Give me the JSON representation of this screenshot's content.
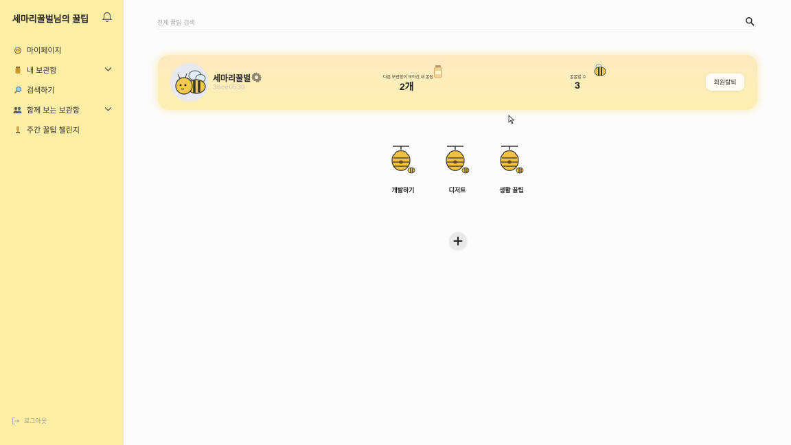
{
  "sidebar": {
    "title": "세마리꿀벌님의 꿀팁",
    "items": [
      {
        "label": "마이페이지",
        "icon": "bee-face-icon",
        "has_chevron": false
      },
      {
        "label": "내 보관함",
        "icon": "jar-icon",
        "has_chevron": true
      },
      {
        "label": "검색하기",
        "icon": "magnifier-icon",
        "has_chevron": false
      },
      {
        "label": "함께 보는 보관함",
        "icon": "people-icon",
        "has_chevron": true
      },
      {
        "label": "주간 꿀팁 챌린지",
        "icon": "trophy-icon",
        "has_chevron": false
      }
    ],
    "logout_label": "로그아웃"
  },
  "search": {
    "placeholder": "전체 꿀팁 검색"
  },
  "profile": {
    "nickname": "세마리꿀벌",
    "user_id": "3bee0530",
    "stat_folders_label": "다른 보관함이 모아간 내 꿀팁",
    "stat_folders_value": "2개",
    "stat_bees_label": "꿀꿀벌 수",
    "stat_bees_value": "3",
    "withdraw_label": "회원탈퇴"
  },
  "folders": [
    {
      "name": "개발하기"
    },
    {
      "name": "디저트"
    },
    {
      "name": "생활 꿀팁"
    }
  ],
  "colors": {
    "sidebar_bg": "#fdeea6",
    "honey": "#f2c94c",
    "honey_dark": "#c9962a",
    "page_bg": "#fcfcfc"
  }
}
